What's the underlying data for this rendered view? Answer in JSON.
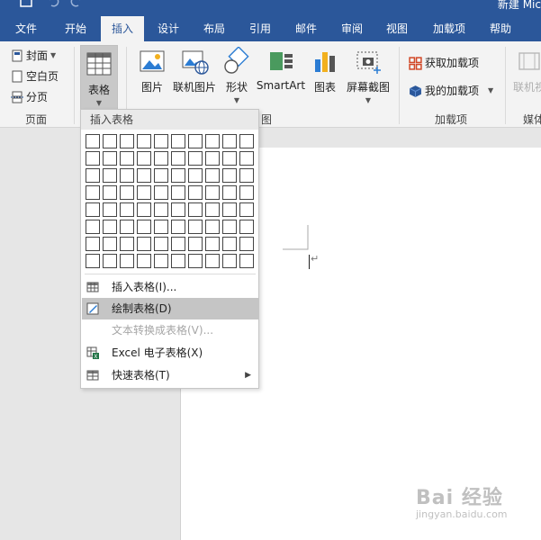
{
  "window": {
    "doc_title": "新建 Mic"
  },
  "tabs": [
    {
      "label": "文件"
    },
    {
      "label": "开始"
    },
    {
      "label": "插入"
    },
    {
      "label": "设计"
    },
    {
      "label": "布局"
    },
    {
      "label": "引用"
    },
    {
      "label": "邮件"
    },
    {
      "label": "审阅"
    },
    {
      "label": "视图"
    },
    {
      "label": "加载项"
    },
    {
      "label": "帮助"
    }
  ],
  "ribbon": {
    "pages_group": {
      "label": "页面",
      "cover": "封面",
      "blank": "空白页",
      "break": "分页"
    },
    "table_btn": "表格",
    "illustrations": {
      "picture": "图片",
      "online_picture": "联机图片",
      "shapes": "形状",
      "smartart": "SmartArt",
      "chart": "图表",
      "screenshot": "屏幕截图",
      "label_partial": "图"
    },
    "addins_group": {
      "label": "加载项",
      "get": "获取加载项",
      "mine": "我的加载项"
    },
    "media_group": {
      "online_video": "联机视",
      "label": "媒体"
    }
  },
  "dropdown": {
    "header": "插入表格",
    "items": [
      {
        "label": "插入表格(I)..."
      },
      {
        "label": "绘制表格(D)"
      },
      {
        "label": "文本转换成表格(V)..."
      },
      {
        "label": "Excel 电子表格(X)"
      },
      {
        "label": "快速表格(T)"
      }
    ]
  },
  "document": {
    "para_mark": "↵"
  },
  "watermark": {
    "main": "Bai 经验",
    "sub": "jingyan.baidu.com"
  }
}
